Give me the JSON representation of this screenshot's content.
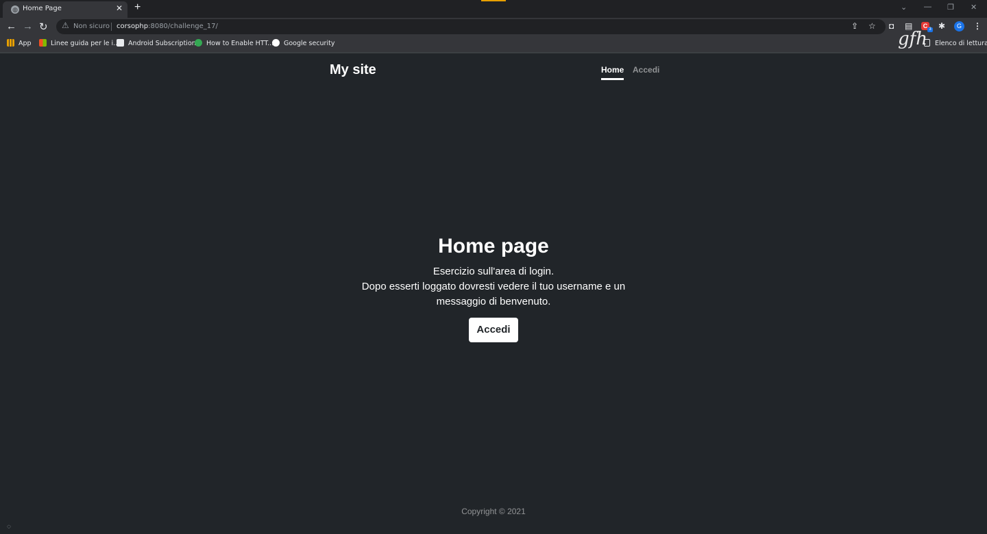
{
  "browser": {
    "tab_title": "Home Page",
    "tab_close": "✕",
    "new_tab": "+",
    "window_controls": [
      "⌄",
      "—",
      "❐",
      "✕"
    ],
    "back": "←",
    "forward": "→",
    "reload": "↻",
    "security_label": "Non sicuro",
    "url_host": "corsophp",
    "url_rest": ":8080/challenge_17/",
    "extension_badge": "3",
    "avatar_letter": "G",
    "menu": "⋮"
  },
  "bookmarks": {
    "items": [
      {
        "label": "App",
        "icon": "apps-grid-icon",
        "color": "#e8a000"
      },
      {
        "label": "Linee guida per le i...",
        "icon": "microsoft-icon",
        "color": "#f25022"
      },
      {
        "label": "Android Subscription",
        "icon": "doc-icon",
        "color": "#e8eaed"
      },
      {
        "label": "How to Enable HTT...",
        "icon": "globe-green-icon",
        "color": "#34a853"
      },
      {
        "label": "Google security",
        "icon": "google-icon",
        "color": "#ffffff"
      }
    ],
    "reading_list": "Elenco di lettura"
  },
  "watermark": "gfh",
  "site": {
    "brand": "My site",
    "nav": {
      "home": "Home",
      "login": "Accedi"
    },
    "hero": {
      "title": "Home page",
      "line1": "Esercizio sull'area di login.",
      "line2": "Dopo esserti loggato dovresti vedere il tuo username e un messaggio di benvenuto.",
      "button": "Accedi"
    },
    "footer": "Copyright © 2021"
  },
  "colors": {
    "page_bg": "#212529",
    "chrome_bg": "#35363a",
    "tabstrip_bg": "#202124"
  }
}
